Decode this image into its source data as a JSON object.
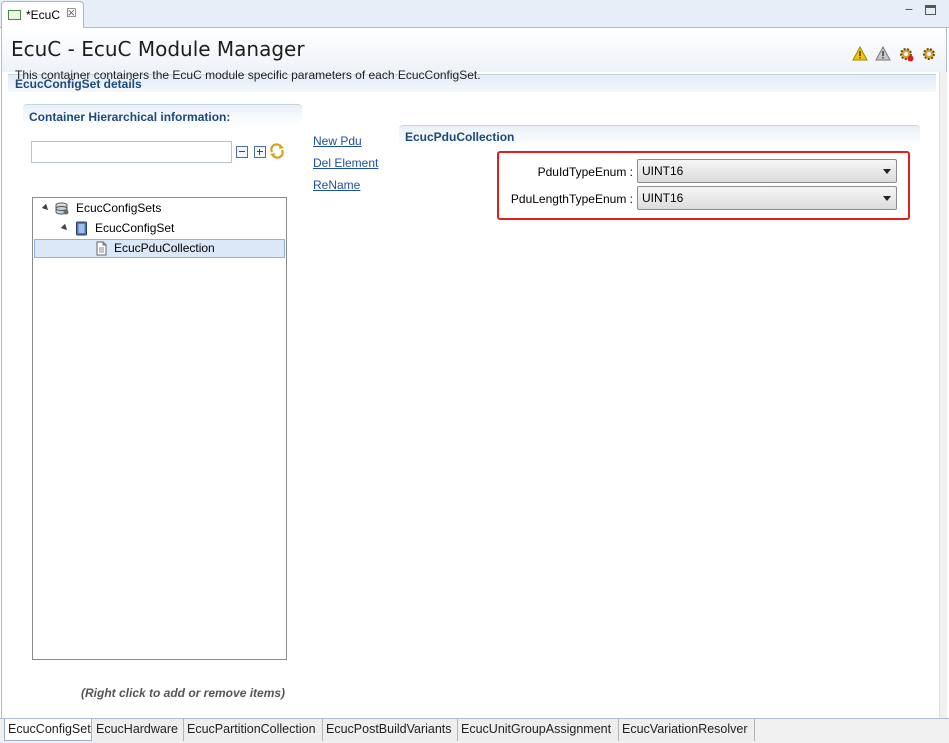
{
  "editor_tab": {
    "label": "*EcuC",
    "close_glyph": "☒"
  },
  "window_controls": {
    "minimize": "−",
    "maximize": "□"
  },
  "header": {
    "title": "EcuC - EcuC Module Manager",
    "icons": [
      "warning-icon",
      "warning-gray-icon",
      "gear-error-icon",
      "gear-icon"
    ]
  },
  "details": {
    "title": "EcucConfigSet details",
    "description": "This container containers the EcuC module specific parameters of each EcucConfigSet."
  },
  "container": {
    "title": "Container Hierarchical information:",
    "filter_value": "",
    "tree": [
      {
        "label": "EcucConfigSets",
        "level": 0,
        "expanded": true,
        "icon": "config-sets-icon"
      },
      {
        "label": "EcucConfigSet",
        "level": 1,
        "expanded": true,
        "icon": "config-set-icon"
      },
      {
        "label": "EcucPduCollection",
        "level": 2,
        "selected": true,
        "icon": "document-icon"
      }
    ],
    "hint": "(Right click to add or remove items)"
  },
  "actions": {
    "new_pdu": "New Pdu",
    "del_element": "Del Element",
    "rename": "ReName"
  },
  "collection": {
    "title": "EcucPduCollection",
    "fields": [
      {
        "label": "PduIdTypeEnum :",
        "value": "UINT16"
      },
      {
        "label": "PduLengthTypeEnum :",
        "value": "UINT16"
      }
    ]
  },
  "bottom_tabs": [
    {
      "label": "EcucConfigSet",
      "active": true
    },
    {
      "label": "EcucHardware",
      "active": false
    },
    {
      "label": "EcucPartitionCollection",
      "active": false
    },
    {
      "label": "EcucPostBuildVariants",
      "active": false
    },
    {
      "label": "EcucUnitGroupAssignment",
      "active": false
    },
    {
      "label": "EcucVariationResolver",
      "active": false
    }
  ],
  "colors": {
    "accent_title": "#1a4a7a",
    "link": "#1d4f9c",
    "highlight": "#e02020",
    "selection": "#dbe8f8"
  }
}
